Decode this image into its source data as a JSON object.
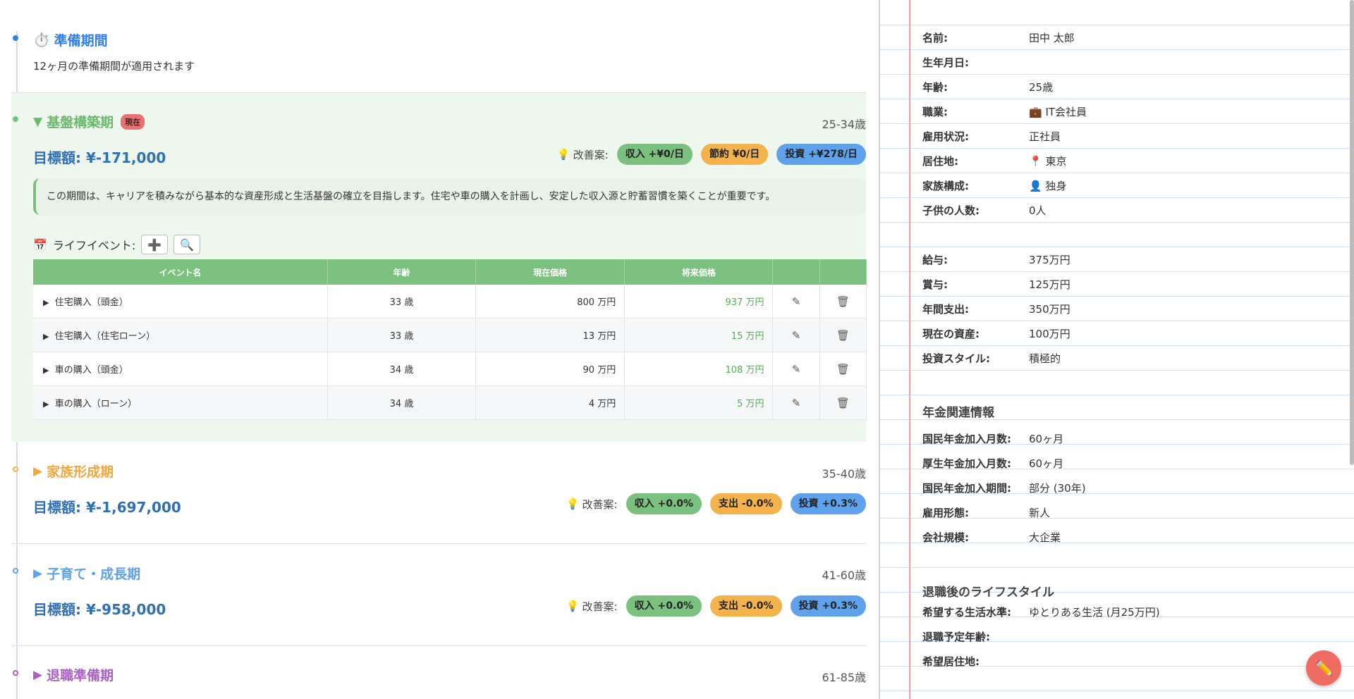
{
  "phases": {
    "prep": {
      "icon": "⏱️",
      "title": "準備期間",
      "subtitle": "12ヶ月の準備期間が適用されます"
    },
    "foundation": {
      "title": "基盤構築期",
      "badge": "現在",
      "age": "25-34歳",
      "target": "目標額: ¥-171,000",
      "improve_label": "改善案:",
      "pills": [
        "収入 +¥0/日",
        "節約 ¥0/日",
        "投資 +¥278/日"
      ],
      "description": "この期間は、キャリアを積みながら基本的な資産形成と生活基盤の確立を目指します。住宅や車の購入を計画し、安定した収入源と貯蓄習慣を築くことが重要です。",
      "events_label": "ライフイベント:",
      "events_icon": "📅",
      "add_icon": "➕",
      "search_icon": "🔍",
      "table_headers": [
        "イベント名",
        "年齢",
        "現在価格",
        "将来価格",
        "",
        ""
      ],
      "events": [
        {
          "name": "住宅購入（頭金）",
          "age": "33 歳",
          "current": "800 万円",
          "future": "937 万円"
        },
        {
          "name": "住宅購入（住宅ローン）",
          "age": "33 歳",
          "current": "13 万円",
          "future": "15 万円"
        },
        {
          "name": "車の購入（頭金）",
          "age": "34 歳",
          "current": "90 万円",
          "future": "108 万円"
        },
        {
          "name": "車の購入（ローン）",
          "age": "34 歳",
          "current": "4 万円",
          "future": "5 万円"
        }
      ]
    },
    "family": {
      "title": "家族形成期",
      "age": "35-40歳",
      "target": "目標額: ¥-1,697,000",
      "improve_label": "改善案:",
      "pills": [
        "収入 +0.0%",
        "支出 -0.0%",
        "投資 +0.3%"
      ]
    },
    "childcare": {
      "title": "子育て・成長期",
      "age": "41-60歳",
      "target": "目標額: ¥-958,000",
      "improve_label": "改善案:",
      "pills": [
        "収入 +0.0%",
        "支出 -0.0%",
        "投資 +0.3%"
      ]
    },
    "retire_prep": {
      "title": "退職準備期",
      "age": "61-85歳"
    }
  },
  "profile": {
    "basic": [
      {
        "k": "名前:",
        "v": "田中 太郎"
      },
      {
        "k": "生年月日:",
        "v": ""
      },
      {
        "k": "年齢:",
        "v": "25歳"
      },
      {
        "k": "職業:",
        "v": "💼 IT会社員"
      },
      {
        "k": "雇用状況:",
        "v": "正社員"
      },
      {
        "k": "居住地:",
        "v": "📍 東京"
      },
      {
        "k": "家族構成:",
        "v": "👤 独身"
      },
      {
        "k": "子供の人数:",
        "v": "0人"
      }
    ],
    "finance": [
      {
        "k": "給与:",
        "v": "375万円"
      },
      {
        "k": "賞与:",
        "v": "125万円"
      },
      {
        "k": "年間支出:",
        "v": "350万円"
      },
      {
        "k": "現在の資産:",
        "v": "100万円"
      },
      {
        "k": "投資スタイル:",
        "v": "積極的"
      }
    ],
    "pension_title": "年金関連情報",
    "pension": [
      {
        "k": "国民年金加入月数:",
        "v": "60ヶ月"
      },
      {
        "k": "厚生年金加入月数:",
        "v": "60ヶ月"
      },
      {
        "k": "国民年金加入期間:",
        "v": "部分 (30年)"
      },
      {
        "k": "雇用形態:",
        "v": "新人"
      },
      {
        "k": "会社規模:",
        "v": "大企業"
      }
    ],
    "retire_title": "退職後のライフスタイル",
    "retire": [
      {
        "k": "希望する生活水準:",
        "v": "ゆとりある生活 (月25万円)"
      },
      {
        "k": "退職予定年齢:",
        "v": ""
      },
      {
        "k": "希望居住地:",
        "v": ""
      }
    ]
  },
  "fab_icon": "✏️",
  "colors": {
    "blue": "#2f6fb5",
    "green": "#7cc07f",
    "orange": "#f4b24d",
    "purple": "#a95fc4",
    "light_blue": "#5fa1ea",
    "red": "#e57373"
  }
}
